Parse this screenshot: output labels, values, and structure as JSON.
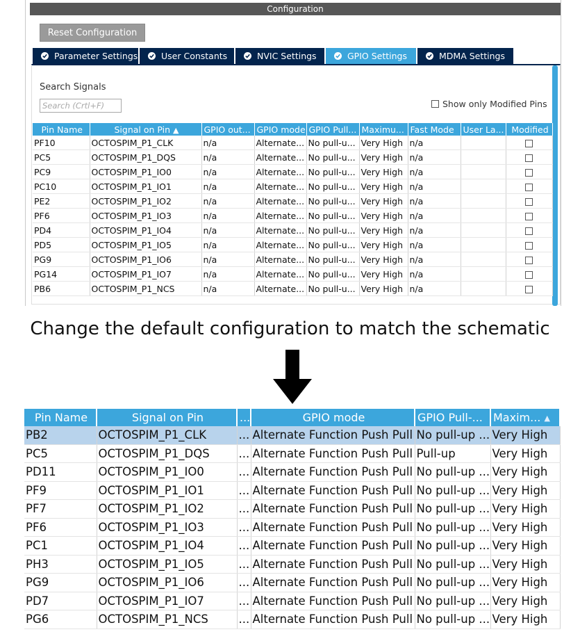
{
  "config": {
    "title": "Configuration",
    "reset_label": "Reset Configuration",
    "tabs": [
      {
        "label": "Parameter Settings",
        "active": false
      },
      {
        "label": "User Constants",
        "active": false
      },
      {
        "label": "NVIC Settings",
        "active": false
      },
      {
        "label": "GPIO Settings",
        "active": true
      },
      {
        "label": "MDMA Settings",
        "active": false
      }
    ],
    "search_label": "Search Signals",
    "search_placeholder": "Search (Crtl+F)",
    "show_modified_label": "Show only Modified Pins",
    "columns": [
      "Pin Name",
      "Signal on Pin",
      "GPIO out...",
      "GPIO mode",
      "GPIO Pull...",
      "Maximu...",
      "Fast Mode",
      "User La...",
      "Modified"
    ],
    "rows": [
      {
        "pin": "PF10",
        "signal": "OCTOSPIM_P1_CLK",
        "out": "n/a",
        "mode": "Alternate...",
        "pull": "No pull-u...",
        "max": "Very High",
        "fast": "n/a",
        "user": ""
      },
      {
        "pin": "PC5",
        "signal": "OCTOSPIM_P1_DQS",
        "out": "n/a",
        "mode": "Alternate...",
        "pull": "No pull-u...",
        "max": "Very High",
        "fast": "n/a",
        "user": ""
      },
      {
        "pin": "PC9",
        "signal": "OCTOSPIM_P1_IO0",
        "out": "n/a",
        "mode": "Alternate...",
        "pull": "No pull-u...",
        "max": "Very High",
        "fast": "n/a",
        "user": ""
      },
      {
        "pin": "PC10",
        "signal": "OCTOSPIM_P1_IO1",
        "out": "n/a",
        "mode": "Alternate...",
        "pull": "No pull-u...",
        "max": "Very High",
        "fast": "n/a",
        "user": ""
      },
      {
        "pin": "PE2",
        "signal": "OCTOSPIM_P1_IO2",
        "out": "n/a",
        "mode": "Alternate...",
        "pull": "No pull-u...",
        "max": "Very High",
        "fast": "n/a",
        "user": ""
      },
      {
        "pin": "PF6",
        "signal": "OCTOSPIM_P1_IO3",
        "out": "n/a",
        "mode": "Alternate...",
        "pull": "No pull-u...",
        "max": "Very High",
        "fast": "n/a",
        "user": ""
      },
      {
        "pin": "PD4",
        "signal": "OCTOSPIM_P1_IO4",
        "out": "n/a",
        "mode": "Alternate...",
        "pull": "No pull-u...",
        "max": "Very High",
        "fast": "n/a",
        "user": ""
      },
      {
        "pin": "PD5",
        "signal": "OCTOSPIM_P1_IO5",
        "out": "n/a",
        "mode": "Alternate...",
        "pull": "No pull-u...",
        "max": "Very High",
        "fast": "n/a",
        "user": ""
      },
      {
        "pin": "PG9",
        "signal": "OCTOSPIM_P1_IO6",
        "out": "n/a",
        "mode": "Alternate...",
        "pull": "No pull-u...",
        "max": "Very High",
        "fast": "n/a",
        "user": ""
      },
      {
        "pin": "PG14",
        "signal": "OCTOSPIM_P1_IO7",
        "out": "n/a",
        "mode": "Alternate...",
        "pull": "No pull-u...",
        "max": "Very High",
        "fast": "n/a",
        "user": ""
      },
      {
        "pin": "PB6",
        "signal": "OCTOSPIM_P1_NCS",
        "out": "n/a",
        "mode": "Alternate...",
        "pull": "No pull-u...",
        "max": "Very High",
        "fast": "n/a",
        "user": ""
      }
    ]
  },
  "caption": "Change the default configuration to match the schematic",
  "result": {
    "columns": [
      "Pin Name",
      "Signal on Pin",
      "...",
      "GPIO mode",
      "GPIO Pull-...",
      "Maxim..."
    ],
    "rows": [
      {
        "pin": "PB2",
        "signal": "OCTOSPIM_P1_CLK",
        "dots": "...",
        "mode": "Alternate Function Push Pull",
        "pull": "No pull-up ...",
        "max": "Very High",
        "selected": true
      },
      {
        "pin": "PC5",
        "signal": "OCTOSPIM_P1_DQS",
        "dots": "...",
        "mode": "Alternate Function Push Pull",
        "pull": "Pull-up",
        "max": "Very High",
        "selected": false
      },
      {
        "pin": "PD11",
        "signal": "OCTOSPIM_P1_IO0",
        "dots": "...",
        "mode": "Alternate Function Push Pull",
        "pull": "No pull-up ...",
        "max": "Very High",
        "selected": false
      },
      {
        "pin": "PF9",
        "signal": "OCTOSPIM_P1_IO1",
        "dots": "...",
        "mode": "Alternate Function Push Pull",
        "pull": "No pull-up ...",
        "max": "Very High",
        "selected": false
      },
      {
        "pin": "PF7",
        "signal": "OCTOSPIM_P1_IO2",
        "dots": "...",
        "mode": "Alternate Function Push Pull",
        "pull": "No pull-up ...",
        "max": "Very High",
        "selected": false
      },
      {
        "pin": "PF6",
        "signal": "OCTOSPIM_P1_IO3",
        "dots": "...",
        "mode": "Alternate Function Push Pull",
        "pull": "No pull-up ...",
        "max": "Very High",
        "selected": false
      },
      {
        "pin": "PC1",
        "signal": "OCTOSPIM_P1_IO4",
        "dots": "...",
        "mode": "Alternate Function Push Pull",
        "pull": "No pull-up ...",
        "max": "Very High",
        "selected": false
      },
      {
        "pin": "PH3",
        "signal": "OCTOSPIM_P1_IO5",
        "dots": "...",
        "mode": "Alternate Function Push Pull",
        "pull": "No pull-up ...",
        "max": "Very High",
        "selected": false
      },
      {
        "pin": "PG9",
        "signal": "OCTOSPIM_P1_IO6",
        "dots": "...",
        "mode": "Alternate Function Push Pull",
        "pull": "No pull-up ...",
        "max": "Very High",
        "selected": false
      },
      {
        "pin": "PD7",
        "signal": "OCTOSPIM_P1_IO7",
        "dots": "...",
        "mode": "Alternate Function Push Pull",
        "pull": "No pull-up ...",
        "max": "Very High",
        "selected": false
      },
      {
        "pin": "PG6",
        "signal": "OCTOSPIM_P1_NCS",
        "dots": "...",
        "mode": "Alternate Function Push Pull",
        "pull": "No pull-up ...",
        "max": "Very High",
        "selected": false
      }
    ]
  },
  "icons": {
    "tab_check": "check-circle-icon",
    "sort": "sort-ascending-icon",
    "arrow": "arrow-down-icon",
    "checkbox": "checkbox-unchecked-icon"
  },
  "colors": {
    "accent": "#3ca6dc",
    "navy": "#03244d",
    "titlebar": "#575757",
    "selected_row": "#b8d3ec"
  }
}
